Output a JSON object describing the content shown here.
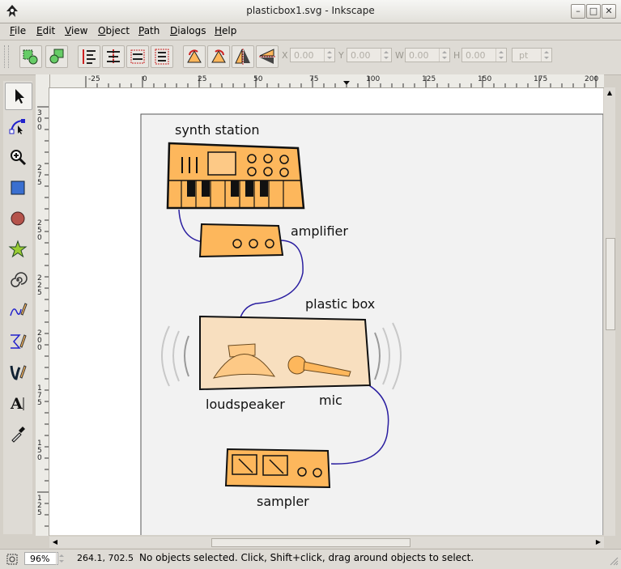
{
  "window": {
    "title": "plasticbox1.svg - Inkscape"
  },
  "menu": {
    "items": [
      {
        "label": "File",
        "u": "F",
        "rest": "ile"
      },
      {
        "label": "Edit",
        "u": "E",
        "rest": "dit"
      },
      {
        "label": "View",
        "u": "V",
        "rest": "iew"
      },
      {
        "label": "Object",
        "u": "O",
        "rest": "bject"
      },
      {
        "label": "Path",
        "u": "P",
        "rest": "ath"
      },
      {
        "label": "Dialogs",
        "u": "D",
        "rest": "ialogs"
      },
      {
        "label": "Help",
        "u": "H",
        "rest": "elp"
      }
    ]
  },
  "toolbar": {
    "fields": [
      {
        "label": "X",
        "value": "0.00"
      },
      {
        "label": "Y",
        "value": "0.00"
      },
      {
        "label": "W",
        "value": "0.00"
      },
      {
        "label": "H",
        "value": "0.00"
      }
    ],
    "unit": "pt"
  },
  "tools": [
    "select-tool",
    "node-tool",
    "zoom-tool",
    "rectangle-tool",
    "ellipse-tool",
    "star-tool",
    "spiral-tool",
    "pencil-tool",
    "pen-tool",
    "calligraphy-tool",
    "text-tool",
    "dropper-tool"
  ],
  "rulers": {
    "h_ticks": [
      "-25",
      "0",
      "25",
      "50",
      "75",
      "100",
      "125",
      "150",
      "175",
      "200"
    ],
    "v_ticks": [
      "300",
      "275",
      "250",
      "225",
      "200",
      "175",
      "150",
      "125"
    ]
  },
  "drawing": {
    "labels": {
      "synth": "synth station",
      "amplifier": "amplifier",
      "plastic_box": "plastic box",
      "loudspeaker": "loudspeaker",
      "mic": "mic",
      "sampler": "sampler"
    }
  },
  "status": {
    "zoom": "96%",
    "coords": "264.1,  702.5",
    "message": "No objects selected. Click, Shift+click, drag around objects to select."
  },
  "colors": {
    "orange": "#fdb75c",
    "box_fill": "#f8dfbf",
    "wire": "#2a1ea0",
    "page_bg": "#f2f2f2"
  }
}
